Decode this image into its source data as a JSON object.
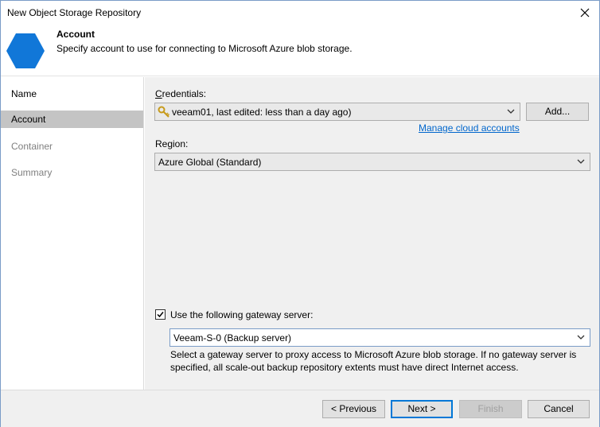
{
  "window": {
    "title": "New Object Storage Repository"
  },
  "header": {
    "title": "Account",
    "description": "Specify account to use for connecting to Microsoft Azure blob storage.",
    "icon": "hexagon-icon",
    "accent": "#1177d8"
  },
  "steps": [
    {
      "label": "Name",
      "state": "done"
    },
    {
      "label": "Account",
      "state": "active"
    },
    {
      "label": "Container",
      "state": "pending"
    },
    {
      "label": "Summary",
      "state": "pending"
    }
  ],
  "credentials": {
    "label": "Credentials:",
    "value": "veeam01, last edited: less than a day ago)",
    "add_label": "Add...",
    "manage_link": "Manage cloud accounts"
  },
  "region": {
    "label": "Region:",
    "value": "Azure Global (Standard)"
  },
  "gateway": {
    "checkbox_label": "Use the following gateway server:",
    "checked": true,
    "value": "Veeam-S-0 (Backup server)",
    "hint_line1": "Select a gateway server to proxy access to Microsoft Azure blob storage. If no gateway server is",
    "hint_line2": "specified, all scale-out backup repository extents must have direct Internet access."
  },
  "footer": {
    "previous": "< Previous",
    "next": "Next >",
    "finish": "Finish",
    "cancel": "Cancel"
  }
}
